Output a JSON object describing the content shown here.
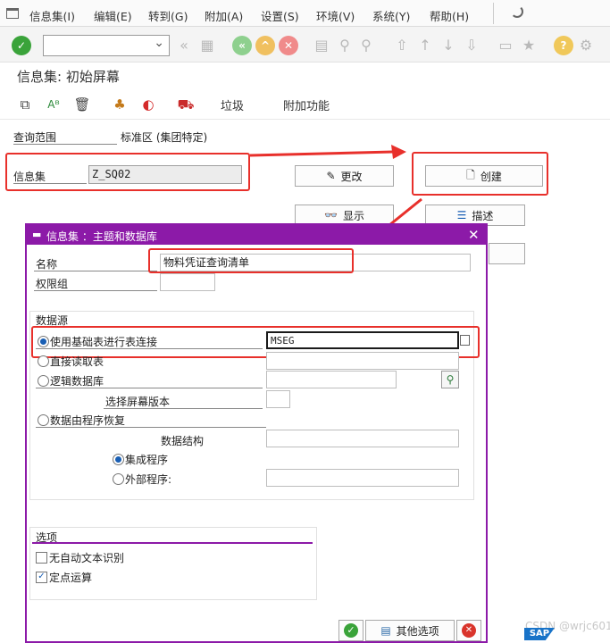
{
  "menu": [
    "信息集(I)",
    "编辑(E)",
    "转到(G)",
    "附加(A)",
    "设置(S)",
    "环境(V)",
    "系统(Y)",
    "帮助(H)"
  ],
  "screen_title": "信息集: 初始屏幕",
  "app_toolbar": {
    "trash": "垃圾",
    "extras": "附加功能"
  },
  "fields": {
    "query_area_label": "查询范围",
    "query_area_value": "标准区 (集团特定)",
    "infoset_label": "信息集",
    "infoset_value": "Z_SQ02"
  },
  "buttons": {
    "change": "更改",
    "create": "创建",
    "display": "显示",
    "describe": "描述"
  },
  "dialog": {
    "title": "信息集 ：主题和数据库",
    "name_label": "名称",
    "name_value": "物料凭证查询清单",
    "auth_group_label": "权限组",
    "auth_group_value": "",
    "datasource_title": "数据源",
    "opt_table_join": "使用基础表进行表连接",
    "table_join_value": "MSEG",
    "opt_direct_read": "直接读取表",
    "opt_logical_db": "逻辑数据库",
    "screen_version_label": "选择屏幕版本",
    "opt_program": "数据由程序恢复",
    "data_structure_label": "数据结构",
    "opt_integrated": "集成程序",
    "opt_external": "外部程序:",
    "options_title": "选项",
    "chk_no_auto_text": "无自动文本识别",
    "chk_fixed_point": "定点运算",
    "btn_other_options": "其他选项"
  },
  "watermark": "CSDN @wrjc601",
  "logo": "SAP",
  "colors": {
    "dialog_accent": "#8c1aa8",
    "annotation_red": "#e8302b",
    "ok_green": "#3aa33a",
    "cancel_red": "#d9342b"
  }
}
